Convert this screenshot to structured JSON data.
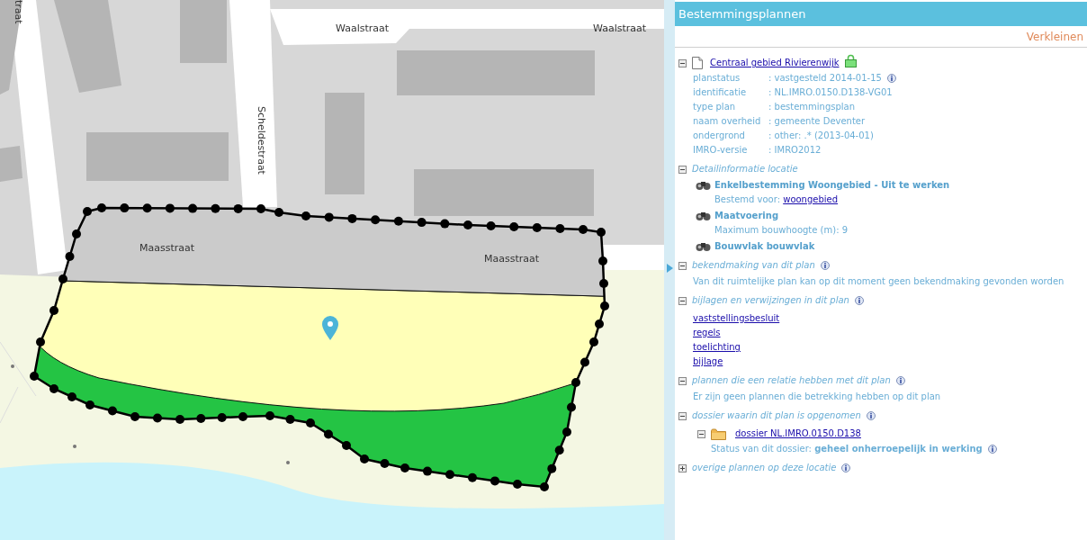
{
  "map": {
    "street_labels": [
      {
        "text": "traat",
        "kind": "vertical"
      },
      {
        "text": "Waalstraat",
        "kind": "flat"
      },
      {
        "text": "Waalstraat",
        "kind": "flat"
      },
      {
        "text": "Scheldestraat",
        "kind": "vertical"
      },
      {
        "text": "Maasstraat",
        "kind": "flat"
      },
      {
        "text": "Maasstraat",
        "kind": "flat"
      }
    ]
  },
  "panel": {
    "title": "Bestemmingsplannen",
    "toolbar": {
      "link": "Verkleinen"
    },
    "plan": {
      "title": "Centraal gebied Rivierenwijk",
      "expanded": true,
      "locked": true,
      "fields": [
        {
          "label": "planstatus",
          "value": ": vastgesteld 2014-01-15",
          "info": true
        },
        {
          "label": "identificatie",
          "value": ": NL.IMRO.0150.D138-VG01",
          "info": false
        },
        {
          "label": "type plan",
          "value": ": bestemmingsplan",
          "info": false
        },
        {
          "label": "naam overheid",
          "value": ": gemeente Deventer",
          "info": false
        },
        {
          "label": "ondergrond",
          "value": ": other: .* (2013-04-01)",
          "info": false
        },
        {
          "label": "IMRO-versie",
          "value": ": IMRO2012",
          "info": false
        }
      ]
    },
    "sections": [
      {
        "title": "Detailinformatie locatie",
        "expanded": true,
        "info": false,
        "kind": "features",
        "features": [
          {
            "title": "Enkelbestemming Woongebied - Uit te werken",
            "detail_label": "Bestemd voor: ",
            "detail_link": "woongebied"
          },
          {
            "title": "Maatvoering",
            "detail_label": "Maximum bouwhoogte (m): 9"
          },
          {
            "title": "Bouwvlak bouwvlak"
          }
        ]
      },
      {
        "title": "bekendmaking van dit plan",
        "expanded": true,
        "info": true,
        "kind": "text",
        "text": "Van dit ruimtelijke plan kan op dit moment geen bekendmaking gevonden worden"
      },
      {
        "title": "bijlagen en verwijzingen in dit plan",
        "expanded": true,
        "info": true,
        "kind": "links",
        "links": [
          "vaststellingsbesluit",
          "regels",
          "toelichting",
          "bijlage"
        ]
      },
      {
        "title": "plannen die een relatie hebben met dit plan",
        "expanded": true,
        "info": true,
        "kind": "text",
        "text": "Er zijn geen plannen die betrekking hebben op dit plan"
      },
      {
        "title": "dossier waarin dit plan is opgenomen",
        "expanded": true,
        "info": true,
        "kind": "dossier",
        "dossier": {
          "title": "dossier NL.IMRO.0150.D138",
          "expanded": true,
          "status_label": "Status van dit dossier: ",
          "status": "geheel onherroepelijk in werking",
          "info": true
        }
      },
      {
        "title": "overige plannen op deze locatie",
        "expanded": false,
        "info": true
      }
    ]
  }
}
